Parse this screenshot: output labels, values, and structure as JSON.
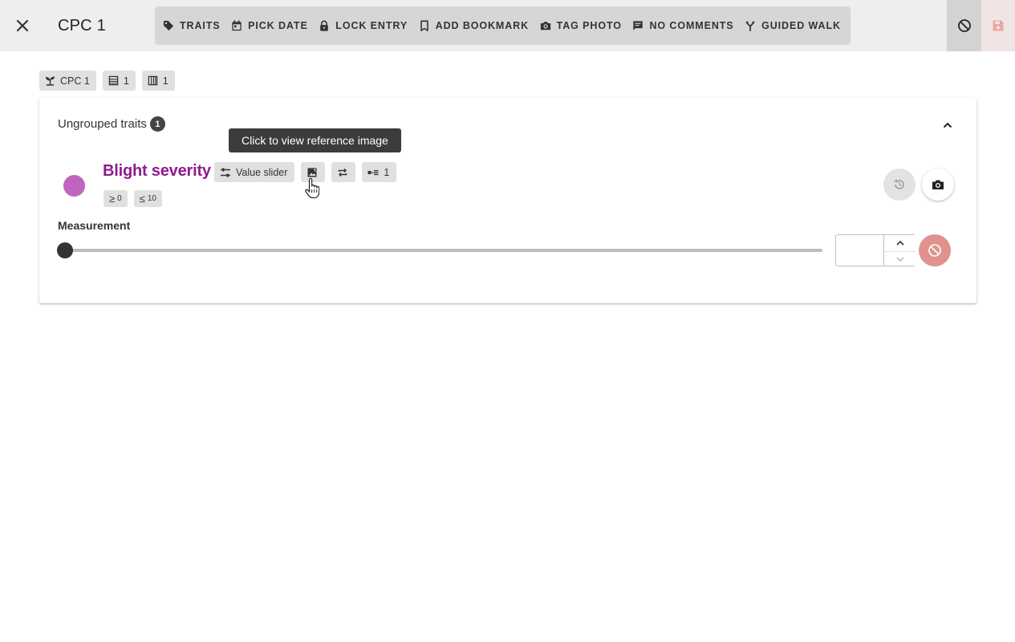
{
  "header": {
    "title": "CPC 1",
    "toolbar": [
      {
        "label": "TRAITS",
        "icon": "tag-icon",
        "name": "traits-button"
      },
      {
        "label": "PICK DATE",
        "icon": "calendar-icon",
        "name": "pick-date-button"
      },
      {
        "label": "LOCK ENTRY",
        "icon": "lock-icon",
        "name": "lock-entry-button"
      },
      {
        "label": "ADD BOOKMARK",
        "icon": "bookmark-icon",
        "name": "add-bookmark-button"
      },
      {
        "label": "TAG PHOTO",
        "icon": "camera-icon",
        "name": "tag-photo-button"
      },
      {
        "label": "NO COMMENTS",
        "icon": "comment-icon",
        "name": "comments-button"
      },
      {
        "label": "GUIDED WALK",
        "icon": "fork-icon",
        "name": "guided-walk-button"
      }
    ]
  },
  "chips": {
    "germplasm": "CPC 1",
    "row": "1",
    "column": "1"
  },
  "group": {
    "title": "Ungrouped traits",
    "count": "1"
  },
  "trait": {
    "name": "Blight severity",
    "color": "#c065bd",
    "name_color": "#8e1c8b",
    "type_label": "Value slider",
    "set_count": "1",
    "min_symbol": "≥",
    "min": "0",
    "max_symbol": "≤",
    "max": "10"
  },
  "measurement": {
    "label": "Measurement",
    "value": "",
    "slider_value": 0
  },
  "tooltip": {
    "text": "Click to view reference image"
  }
}
